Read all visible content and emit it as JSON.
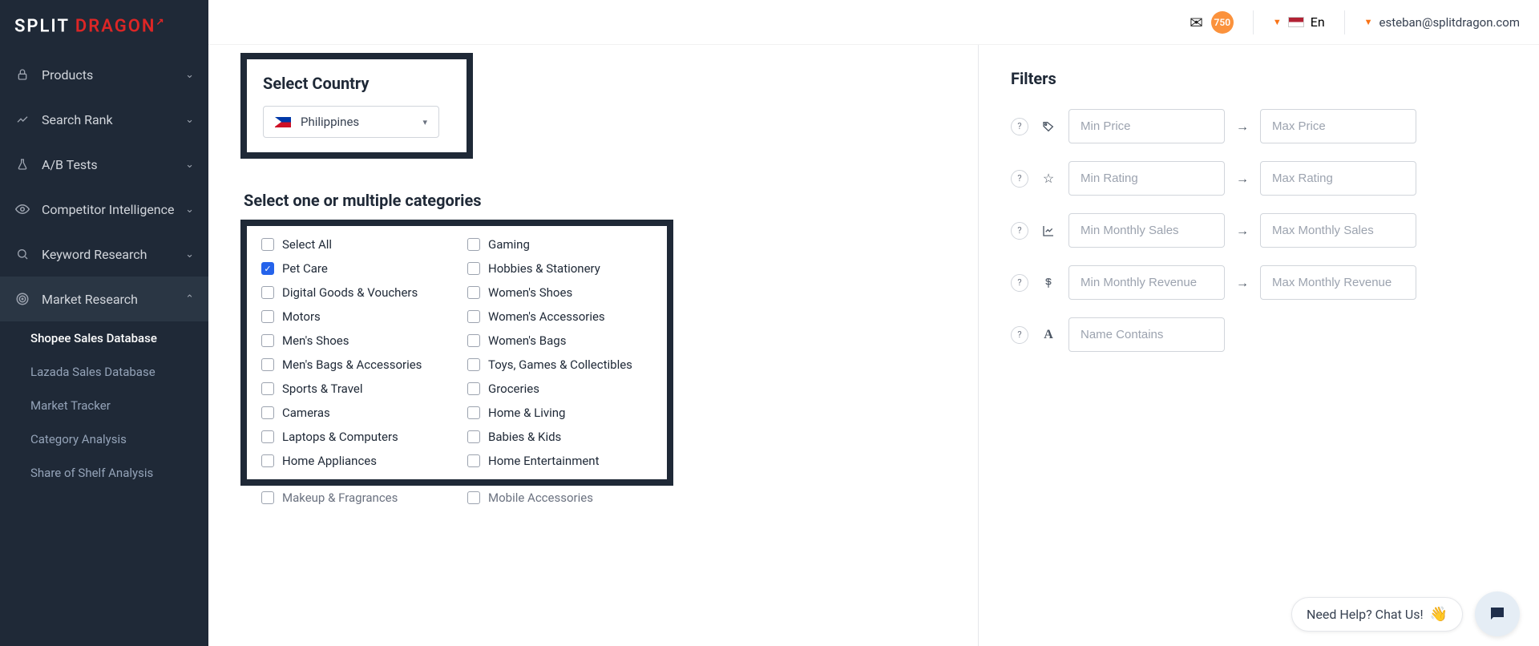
{
  "brand": {
    "part1": "SPLIT ",
    "part2": "DRAG",
    "part3": "O",
    "part4": "N"
  },
  "topbar": {
    "badge": "750",
    "lang": "En",
    "user_email": "esteban@splitdragon.com"
  },
  "sidebar": {
    "items": [
      {
        "label": "Products",
        "icon": "lock"
      },
      {
        "label": "Search Rank",
        "icon": "chart-line"
      },
      {
        "label": "A/B Tests",
        "icon": "flask"
      },
      {
        "label": "Competitor Intelligence",
        "icon": "eye"
      },
      {
        "label": "Keyword Research",
        "icon": "search"
      },
      {
        "label": "Market Research",
        "icon": "target"
      }
    ],
    "subitems": [
      {
        "label": "Shopee Sales Database",
        "active": true
      },
      {
        "label": "Lazada Sales Database",
        "active": false
      },
      {
        "label": "Market Tracker",
        "active": false
      },
      {
        "label": "Category Analysis",
        "active": false
      },
      {
        "label": "Share of Shelf Analysis",
        "active": false
      }
    ]
  },
  "country": {
    "title": "Select Country",
    "selected": "Philippines"
  },
  "categories": {
    "title": "Select one or multiple categories",
    "col1": [
      {
        "label": "Select All",
        "checked": false
      },
      {
        "label": "Pet Care",
        "checked": true
      },
      {
        "label": "Digital Goods & Vouchers",
        "checked": false
      },
      {
        "label": "Motors",
        "checked": false
      },
      {
        "label": "Men's Shoes",
        "checked": false
      },
      {
        "label": "Men's Bags & Accessories",
        "checked": false
      },
      {
        "label": "Sports & Travel",
        "checked": false
      },
      {
        "label": "Cameras",
        "checked": false
      },
      {
        "label": "Laptops & Computers",
        "checked": false
      },
      {
        "label": "Home Appliances",
        "checked": false
      }
    ],
    "col2": [
      {
        "label": "Gaming",
        "checked": false
      },
      {
        "label": "Hobbies & Stationery",
        "checked": false
      },
      {
        "label": "Women's Shoes",
        "checked": false
      },
      {
        "label": "Women's Accessories",
        "checked": false
      },
      {
        "label": "Women's Bags",
        "checked": false
      },
      {
        "label": "Toys, Games & Collectibles",
        "checked": false
      },
      {
        "label": "Groceries",
        "checked": false
      },
      {
        "label": "Home & Living",
        "checked": false
      },
      {
        "label": "Babies & Kids",
        "checked": false
      },
      {
        "label": "Home Entertainment",
        "checked": false
      }
    ],
    "extra1": "Makeup & Fragrances",
    "extra2": "Mobile Accessories"
  },
  "filters": {
    "title": "Filters",
    "rows": [
      {
        "icon": "tag",
        "min_ph": "Min Price",
        "max_ph": "Max Price"
      },
      {
        "icon": "star",
        "min_ph": "Min Rating",
        "max_ph": "Max Rating"
      },
      {
        "icon": "chart",
        "min_ph": "Min Monthly Sales",
        "max_ph": "Max Monthly Sales"
      },
      {
        "icon": "dollar",
        "min_ph": "Min Monthly Revenue",
        "max_ph": "Max Monthly Revenue"
      }
    ],
    "name_row": {
      "icon": "A",
      "ph": "Name Contains"
    }
  },
  "chat": {
    "text": "Need Help? Chat Us!"
  }
}
